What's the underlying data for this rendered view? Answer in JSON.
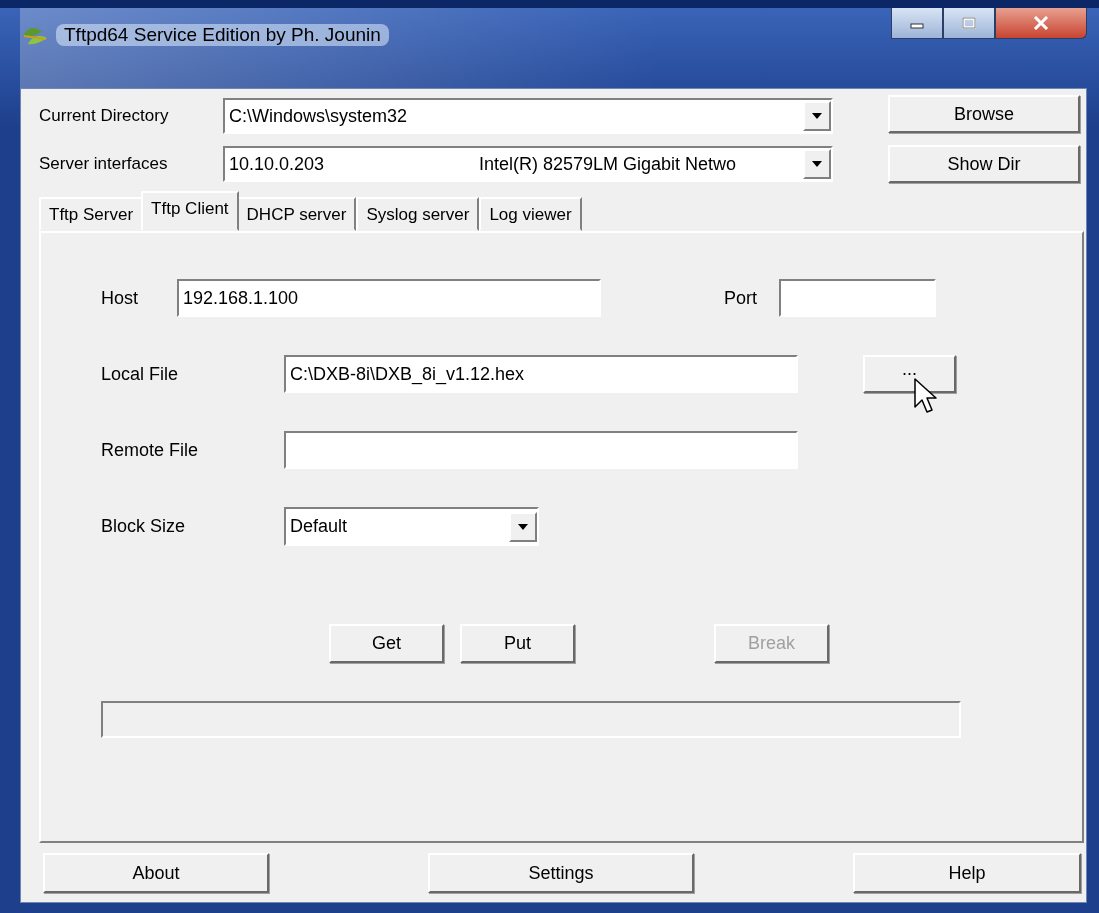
{
  "window": {
    "title": "Tftpd64 Service Edition by Ph. Jounin"
  },
  "current_directory": {
    "label": "Current Directory",
    "value": "C:\\Windows\\system32"
  },
  "server_interfaces": {
    "label": "Server interfaces",
    "value": "10.10.0.203",
    "adapter": "Intel(R) 82579LM Gigabit Netwo"
  },
  "side_buttons": [
    "Browse",
    "Show Dir"
  ],
  "tabs": [
    {
      "label": "Tftp Server",
      "selected": false
    },
    {
      "label": "Tftp Client",
      "selected": true
    },
    {
      "label": "DHCP server",
      "selected": false
    },
    {
      "label": "Syslog server",
      "selected": false
    },
    {
      "label": "Log viewer",
      "selected": false
    }
  ],
  "client": {
    "host": {
      "label": "Host",
      "value": "192.168.1.100"
    },
    "port": {
      "label": "Port"
    },
    "local_file": {
      "label": "Local File",
      "value": "C:\\DXB-8i\\DXB_8i_v1.12.hex",
      "button": "..."
    },
    "remote_file": {
      "label": "Remote File"
    },
    "block_size": {
      "label": "Block Size",
      "value": "Default"
    },
    "actions": [
      {
        "label": "Get",
        "disabled": false
      },
      {
        "label": "Put",
        "disabled": false
      },
      {
        "label": "Break",
        "disabled": true
      }
    ],
    "progress": {
      "level": 0
    }
  },
  "footer_buttons": [
    "About",
    "Settings",
    "Help"
  ]
}
